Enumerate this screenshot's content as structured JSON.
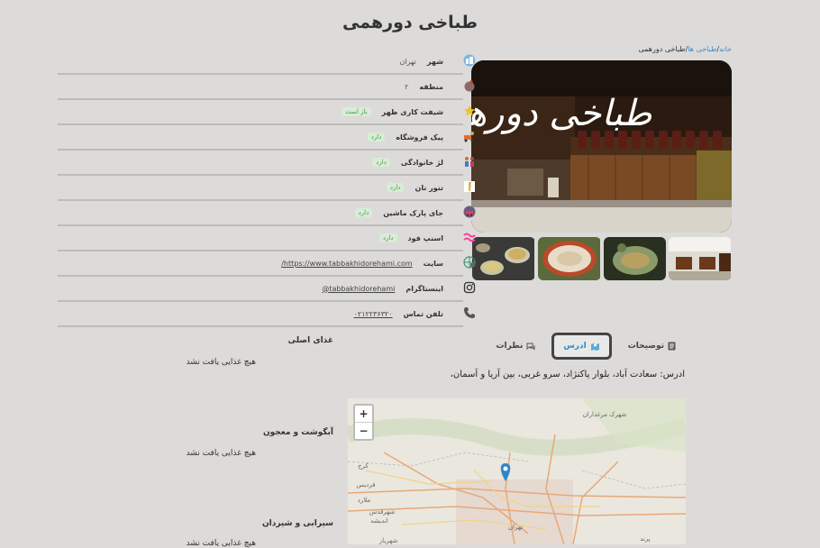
{
  "page": {
    "title": "طباخی دورهمی"
  },
  "breadcrumb": {
    "home": "خانه",
    "sep1": "/",
    "category": "طباخی ها",
    "sep2": "/",
    "current": "طباخی دورهمی"
  },
  "hero": {
    "sign_text": "طباخی دورهمی"
  },
  "info": [
    {
      "label": "شهر",
      "value": "تهران",
      "type": "text",
      "icon": "city-icon"
    },
    {
      "label": "منطقه",
      "value": "۲",
      "type": "text",
      "icon": "region-icon"
    },
    {
      "label": "شیفت کاری ظهر",
      "value": "باز است",
      "type": "badge",
      "icon": "star-icon"
    },
    {
      "label": "پیک فروشگاه",
      "value": "دارد",
      "type": "badge",
      "icon": "delivery-icon"
    },
    {
      "label": "لژ خانوادگی",
      "value": "دارد",
      "type": "badge",
      "icon": "family-icon"
    },
    {
      "label": "تنور نان",
      "value": "دارد",
      "type": "badge",
      "icon": "bread-oven-icon"
    },
    {
      "label": "جای پارک ماشین",
      "value": "دارد",
      "type": "badge",
      "icon": "parking-icon"
    },
    {
      "label": "اسنپ فود",
      "value": "دارد",
      "type": "badge",
      "icon": "snappfood-icon"
    },
    {
      "label": "سایت",
      "value": "https://www.tabbakhidorehami.com/",
      "type": "link",
      "icon": "website-icon"
    },
    {
      "label": "اینستاگرام",
      "value": "tabbakhidorehami@",
      "type": "link",
      "icon": "instagram-icon"
    },
    {
      "label": "تلفن تماس",
      "value": "۰۲۱۲۲۳۶۳۲۰",
      "type": "link",
      "icon": "phone-icon"
    }
  ],
  "tabs": [
    {
      "label": "توضیحات",
      "icon": "document-icon",
      "active": false
    },
    {
      "label": "ادرس",
      "icon": "map-icon",
      "active": true
    },
    {
      "label": "نظرات",
      "icon": "comments-icon",
      "active": false
    }
  ],
  "address": {
    "text": "ادرس: سعادت آباد، بلوار پاکنژاد، سرو غربی، بین آریا و آسمان،"
  },
  "map": {
    "zoom_in": "+",
    "zoom_out": "−",
    "labels": [
      "کرج",
      "شهرقدس",
      "اندیشه",
      "شهریار",
      "تهران",
      "فردیس",
      "ملارد",
      "شهرک مرغداران",
      "پرند"
    ]
  },
  "menu_sections": [
    {
      "title": "غذای اصلی",
      "empty": "هیچ غذایی یافت نشد"
    },
    {
      "title": "آبگوشت و معجون",
      "empty": "هیچ غذایی یافت نشد"
    },
    {
      "title": "سیرابی و شیردان",
      "empty": "هیچ غذایی یافت نشد"
    }
  ]
}
